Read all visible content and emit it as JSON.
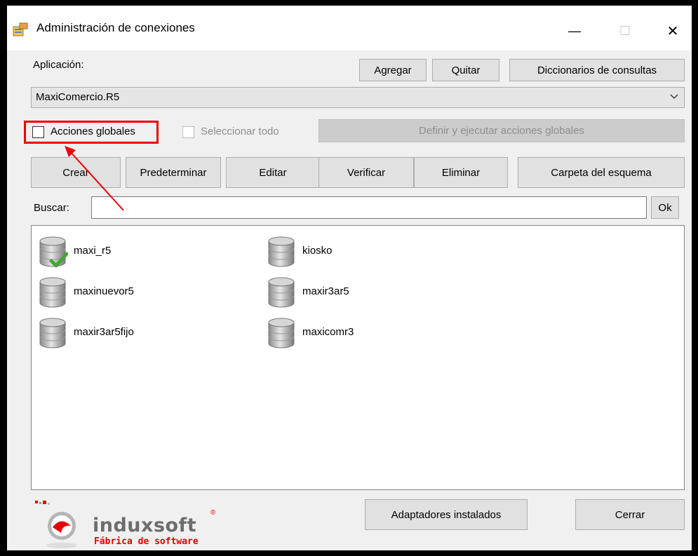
{
  "window": {
    "title": "Administración de conexiones",
    "controls": {
      "minimize": "—",
      "maximize": "☐",
      "close": "✕"
    }
  },
  "application": {
    "label": "Aplicación:",
    "add_label": "Agregar",
    "remove_label": "Quitar",
    "dictionaries_label": "Diccionarios de consultas",
    "selected": "MaxiComercio.R5"
  },
  "global_actions": {
    "checkbox_label": "Acciones globales",
    "checked": false,
    "select_all_label": "Seleccionar todo",
    "define_label": "Definir y ejecutar acciones globales"
  },
  "toolbar": {
    "create_label": "Crear",
    "default_label": "Predeterminar",
    "edit_label": "Editar",
    "verify_label": "Verificar",
    "delete_label": "Eliminar",
    "schema_folder_label": "Carpeta del esquema"
  },
  "search": {
    "label": "Buscar:",
    "value": "",
    "ok_label": "Ok"
  },
  "connections": [
    {
      "name": "maxi_r5",
      "icon": "database-check-icon",
      "default": true
    },
    {
      "name": "kiosko",
      "icon": "database-icon"
    },
    {
      "name": "maxinuevor5",
      "icon": "database-icon"
    },
    {
      "name": "maxir3ar5",
      "icon": "database-icon"
    },
    {
      "name": "maxir3ar5fijo",
      "icon": "database-icon"
    },
    {
      "name": "maxicomr3",
      "icon": "database-icon"
    }
  ],
  "footer": {
    "adapters_label": "Adaptadores instalados",
    "close_label": "Cerrar",
    "logo_name": "induxsoft",
    "logo_tagline": "Fábrica de software",
    "logo_mark": "®"
  },
  "colors": {
    "highlight": "#e00000",
    "logo_red": "#e60000",
    "logo_gray": "#6d6d6d"
  }
}
